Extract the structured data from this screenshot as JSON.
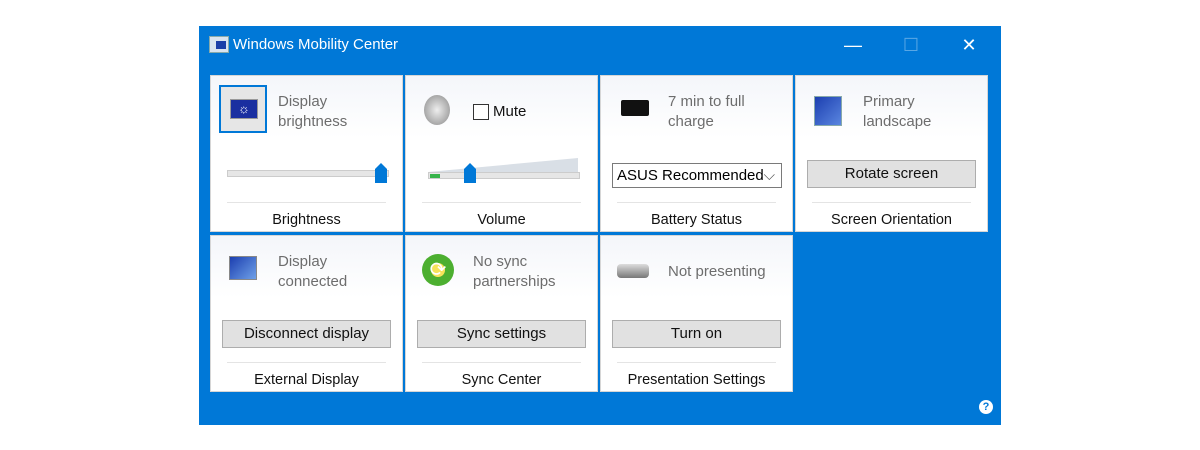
{
  "window": {
    "title": "Windows Mobility Center",
    "minimize": "—",
    "maximize": "☐",
    "close": "✕",
    "help": "?"
  },
  "tiles": {
    "brightness": {
      "text": "Display brightness",
      "label": "Brightness",
      "level_percent": 100
    },
    "volume": {
      "mute_label": "Mute",
      "muted": false,
      "label": "Volume",
      "level_percent": 28
    },
    "battery": {
      "text": "7 min to full charge",
      "plan": "ASUS Recommended",
      "label": "Battery Status"
    },
    "orientation": {
      "text": "Primary landscape",
      "button": "Rotate screen",
      "label": "Screen Orientation"
    },
    "display": {
      "text": "Display connected",
      "button": "Disconnect display",
      "label": "External Display"
    },
    "sync": {
      "text": "No sync partnerships",
      "button": "Sync settings",
      "label": "Sync Center"
    },
    "presentation": {
      "text": "Not presenting",
      "button": "Turn on",
      "label": "Presentation Settings"
    }
  },
  "colors": {
    "accent": "#0078d7"
  }
}
